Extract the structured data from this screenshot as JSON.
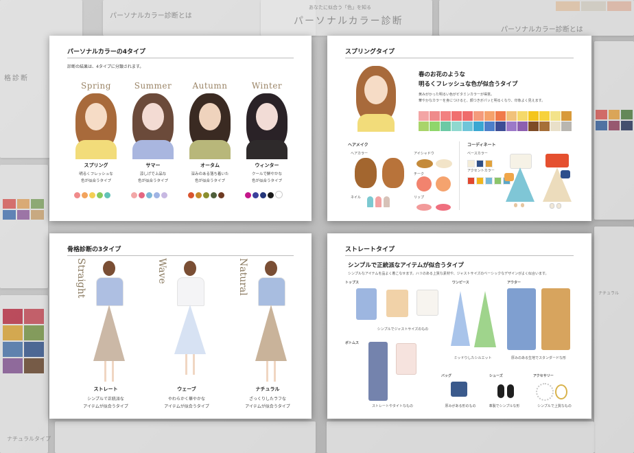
{
  "background": {
    "titles": [
      "パーソナルカラー診断とは",
      "パーソナルカラー診断",
      "あなたに似合う「色」を知る",
      "パーソナルカラーの4タイプ",
      "骨格診断の3タイプ",
      "ストレートタイプ",
      "格診断",
      "ナチュラル",
      "ナチュラルタイプ"
    ]
  },
  "card1": {
    "title": "パーソナルカラーの4タイプ",
    "intro": "診断の結果は、4タイプに分類されます。",
    "seasons": [
      {
        "en": "Spring",
        "jp": "スプリング",
        "desc1": "明るくフレッシュな",
        "desc2": "色が似合うタイプ",
        "hair": "#a86a3b",
        "skin": "#f6dcc6",
        "top": "#f2dc7a",
        "dots": [
          "#f08a8a",
          "#f2a35d",
          "#f4cf54",
          "#88c95f",
          "#62c3b7"
        ]
      },
      {
        "en": "Summer",
        "jp": "サマー",
        "desc1": "涼しげで上品な",
        "desc2": "色が似合うタイプ",
        "hair": "#6b4a3a",
        "skin": "#f3dbd3",
        "top": "#a9b6df",
        "dots": [
          "#f2a7a7",
          "#e56781",
          "#7eb7d6",
          "#9fb4e4",
          "#c7b8e2"
        ]
      },
      {
        "en": "Autumn",
        "jp": "オータム",
        "desc1": "深みのある落ち着いた",
        "desc2": "色が似合うタイプ",
        "hair": "#3a2a22",
        "skin": "#efd3bd",
        "top": "#b8b77a",
        "dots": [
          "#d9542f",
          "#c48a2b",
          "#8a8f2e",
          "#4e5e3a",
          "#6e3b22"
        ]
      },
      {
        "en": "Winter",
        "jp": "ウィンター",
        "desc1": "クールで鮮やかな",
        "desc2": "色が似合うタイプ",
        "hair": "#2a2227",
        "skin": "#f2dcd6",
        "top": "#2e2a2b",
        "dots": [
          "#c4168a",
          "#3a3f9c",
          "#24367a",
          "#1b1b1b",
          "#ffffff"
        ]
      }
    ]
  },
  "card2": {
    "title": "スプリングタイプ",
    "headline1": "春のお花のような",
    "headline2": "明るくフレッシュな色が似合うタイプ",
    "body1": "黄みがかった明るい色がビタミンカラーが得意。",
    "body2": "華やかなカラーを身につけると、顔つきがパッと明るくなり、印象よく見えます。",
    "palette_row1": [
      "#f3a5a5",
      "#ef8b8b",
      "#f28080",
      "#f06f6f",
      "#ef6b6b",
      "#f49b7c",
      "#f5a26b",
      "#f07a4a",
      "#f1c27b",
      "#f5d96a",
      "#f4c51c",
      "#f7d23c",
      "#f3e38a",
      "#d89a3a"
    ],
    "palette_row2": [
      "#a9d46a",
      "#8fd66b",
      "#6cc9a5",
      "#8fd8cf",
      "#6fc5d9",
      "#3aa7d2",
      "#4d7fc9",
      "#3d4d95",
      "#9c79c8",
      "#8d5fb0",
      "#7e4c26",
      "#a66f38",
      "#e9e0c9",
      "#b9b6b0"
    ],
    "makeup_label": "ヘアメイク",
    "haircolor_label": "ヘアカラー",
    "eyeshadow_label": "アイシャドウ",
    "cheek_label": "チーク",
    "lip_label": "リップ",
    "nail_label": "ネイル",
    "coordinate_label": "コーディネート",
    "base_label": "ベースカラー",
    "accent_label": "アクセントカラー",
    "base_colors": [
      "#f3ecd8",
      "#2f4f86",
      "#e1a23c"
    ],
    "accent_colors": [
      "#e1472f",
      "#f1b51c",
      "#74b7d8",
      "#8cc56a",
      "#5ba7c8"
    ]
  },
  "card3": {
    "title": "骨格診断の3タイプ",
    "types": [
      {
        "en": "Straight",
        "jp": "ストレート",
        "desc1": "シンプルで正統派な",
        "desc2": "アイテムが似合うタイプ",
        "top": "#aebfe2",
        "bottom": "#cbb8a6"
      },
      {
        "en": "Wave",
        "jp": "ウェーブ",
        "desc1": "やわらかく華やかな",
        "desc2": "アイテムが似合うタイプ",
        "top": "#f4f4f6",
        "bottom": "#d7e2f3"
      },
      {
        "en": "Natural",
        "jp": "ナチュラル",
        "desc1": "ざっくりしたラフな",
        "desc2": "アイテムが似合うタイプ",
        "top": "#a8bde0",
        "bottom": "#c9b39a"
      }
    ]
  },
  "card4": {
    "title": "ストレートタイプ",
    "headline": "シンプルで正統派なアイテムが似合うタイプ",
    "body": "シンプルなアイテムを品よく着こなせます。ハリのある上質な素材や、ジャストサイズのベーシックなデザインがよく似合います。",
    "tops_label": "トップス",
    "onepiece_label": "ワンピース",
    "outer_label": "アウター",
    "bottoms_label": "ボトムス",
    "bag_label": "バッグ",
    "shoes_label": "シューズ",
    "accessory_label": "アクセサリー",
    "tops_caption": "シンプルでジャストサイズのもの",
    "onepiece_caption": "ミッドりしたシルエット",
    "outer_caption": "厚みのある生地でスタンダードな形",
    "bottoms_caption": "ストレートやタイトなもの",
    "bag_caption": "厚みがある形のもの",
    "shoes_caption": "革製でシンプルな形",
    "accessory_caption": "シンプルで上質なもの"
  }
}
